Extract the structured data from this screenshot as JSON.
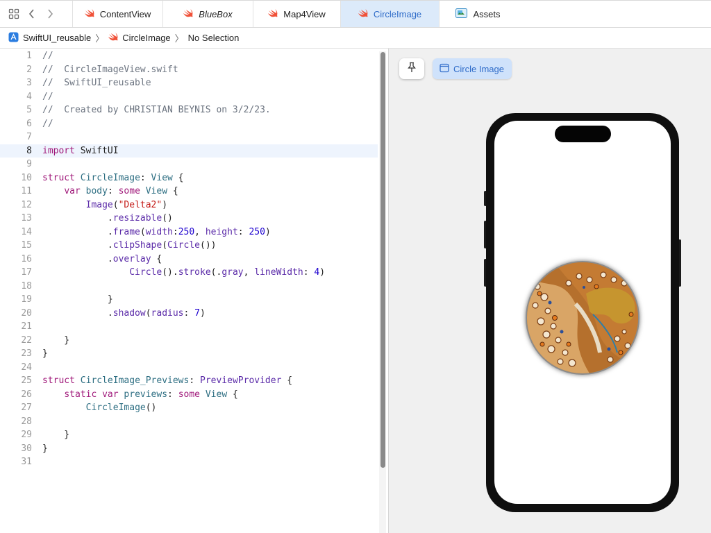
{
  "toolbar": {
    "nav": [
      "grid-icon",
      "back-icon",
      "forward-icon"
    ],
    "tabs": [
      {
        "label": "ContentView",
        "icon": "swift-icon",
        "italic": false,
        "active": false
      },
      {
        "label": "BlueBox",
        "icon": "swift-icon",
        "italic": true,
        "active": false
      },
      {
        "label": "Map4View",
        "icon": "swift-icon",
        "italic": false,
        "active": false
      },
      {
        "label": "CircleImage",
        "icon": "swift-icon",
        "italic": false,
        "active": true
      },
      {
        "label": "Assets",
        "icon": "asset-catalog-icon",
        "italic": false,
        "active": false
      }
    ]
  },
  "breadcrumb": {
    "project": "SwiftUI_reusable",
    "file": "CircleImage",
    "selection": "No Selection"
  },
  "editor": {
    "current_line": 8,
    "lines": [
      {
        "n": "1",
        "t": [
          [
            "cmt",
            "//"
          ]
        ]
      },
      {
        "n": "2",
        "t": [
          [
            "cmt",
            "//  CircleImageView.swift"
          ]
        ]
      },
      {
        "n": "3",
        "t": [
          [
            "cmt",
            "//  SwiftUI_reusable"
          ]
        ]
      },
      {
        "n": "4",
        "t": [
          [
            "cmt",
            "//"
          ]
        ]
      },
      {
        "n": "5",
        "t": [
          [
            "cmt",
            "//  Created by CHRISTIAN BEYNIS on 3/2/23."
          ]
        ]
      },
      {
        "n": "6",
        "t": [
          [
            "cmt",
            "//"
          ]
        ]
      },
      {
        "n": "7",
        "t": []
      },
      {
        "n": "8",
        "t": [
          [
            "kw",
            "import"
          ],
          [
            "",
            " SwiftUI"
          ]
        ]
      },
      {
        "n": "9",
        "t": []
      },
      {
        "n": "10",
        "t": [
          [
            "kw",
            "struct"
          ],
          [
            "",
            " "
          ],
          [
            "ty",
            "CircleImage"
          ],
          [
            "",
            ": "
          ],
          [
            "ty",
            "View"
          ],
          [
            "",
            " {"
          ]
        ]
      },
      {
        "n": "11",
        "t": [
          [
            "",
            "    "
          ],
          [
            "kw",
            "var"
          ],
          [
            "",
            " "
          ],
          [
            "ty",
            "body"
          ],
          [
            "",
            ": "
          ],
          [
            "kw",
            "some"
          ],
          [
            "",
            " "
          ],
          [
            "ty",
            "View"
          ],
          [
            "",
            " {"
          ]
        ]
      },
      {
        "n": "12",
        "t": [
          [
            "",
            "        "
          ],
          [
            "fn",
            "Image"
          ],
          [
            "",
            "("
          ],
          [
            "str",
            "\"Delta2\""
          ],
          [
            "",
            ")"
          ]
        ]
      },
      {
        "n": "13",
        "t": [
          [
            "",
            "            ."
          ],
          [
            "fn",
            "resizable"
          ],
          [
            "",
            "()"
          ]
        ]
      },
      {
        "n": "14",
        "t": [
          [
            "",
            "            ."
          ],
          [
            "fn",
            "frame"
          ],
          [
            "",
            "("
          ],
          [
            "fn",
            "width"
          ],
          [
            "",
            ":"
          ],
          [
            "num",
            "250"
          ],
          [
            "",
            ", "
          ],
          [
            "fn",
            "height"
          ],
          [
            "",
            ": "
          ],
          [
            "num",
            "250"
          ],
          [
            "",
            ")"
          ]
        ]
      },
      {
        "n": "15",
        "t": [
          [
            "",
            "            ."
          ],
          [
            "fn",
            "clipShape"
          ],
          [
            "",
            "("
          ],
          [
            "fn",
            "Circle"
          ],
          [
            "",
            "())"
          ]
        ]
      },
      {
        "n": "16",
        "t": [
          [
            "",
            "            ."
          ],
          [
            "fn",
            "overlay"
          ],
          [
            "",
            " {"
          ]
        ]
      },
      {
        "n": "17",
        "t": [
          [
            "",
            "                "
          ],
          [
            "fn",
            "Circle"
          ],
          [
            "",
            "()."
          ],
          [
            "fn",
            "stroke"
          ],
          [
            "",
            "(."
          ],
          [
            "fn",
            "gray"
          ],
          [
            "",
            ", "
          ],
          [
            "fn",
            "lineWidth"
          ],
          [
            "",
            ": "
          ],
          [
            "num",
            "4"
          ],
          [
            "",
            ")"
          ]
        ]
      },
      {
        "n": "18",
        "t": []
      },
      {
        "n": "19",
        "t": [
          [
            "",
            "            }"
          ]
        ]
      },
      {
        "n": "20",
        "t": [
          [
            "",
            "            ."
          ],
          [
            "fn",
            "shadow"
          ],
          [
            "",
            "("
          ],
          [
            "fn",
            "radius"
          ],
          [
            "",
            ": "
          ],
          [
            "num",
            "7"
          ],
          [
            "",
            ")"
          ]
        ]
      },
      {
        "n": "21",
        "t": []
      },
      {
        "n": "22",
        "t": [
          [
            "",
            "    }"
          ]
        ]
      },
      {
        "n": "23",
        "t": [
          [
            "",
            "}"
          ]
        ]
      },
      {
        "n": "24",
        "t": []
      },
      {
        "n": "25",
        "t": [
          [
            "kw",
            "struct"
          ],
          [
            "",
            " "
          ],
          [
            "ty",
            "CircleImage_Previews"
          ],
          [
            "",
            ": "
          ],
          [
            "fn",
            "PreviewProvider"
          ],
          [
            "",
            " {"
          ]
        ]
      },
      {
        "n": "26",
        "t": [
          [
            "",
            "    "
          ],
          [
            "kw",
            "static"
          ],
          [
            "",
            " "
          ],
          [
            "kw",
            "var"
          ],
          [
            "",
            " "
          ],
          [
            "ty",
            "previews"
          ],
          [
            "",
            ": "
          ],
          [
            "kw",
            "some"
          ],
          [
            "",
            " "
          ],
          [
            "ty",
            "View"
          ],
          [
            "",
            " {"
          ]
        ]
      },
      {
        "n": "27",
        "t": [
          [
            "",
            "        "
          ],
          [
            "ty",
            "CircleImage"
          ],
          [
            "",
            "()"
          ]
        ]
      },
      {
        "n": "28",
        "t": []
      },
      {
        "n": "29",
        "t": [
          [
            "",
            "    }"
          ]
        ]
      },
      {
        "n": "30",
        "t": [
          [
            "",
            "}"
          ]
        ]
      },
      {
        "n": "31",
        "t": []
      }
    ]
  },
  "preview": {
    "pin_icon": "pin-icon",
    "chip_label": "Circle Image",
    "chip_icon": "preview-window-icon",
    "image_name": "Delta2"
  },
  "colors": {
    "accent": "#2f6cc9",
    "swift_orange": "#f05138",
    "keyword": "#a0197a",
    "comment": "#6c7480",
    "string": "#c41a16",
    "number": "#1c00cf"
  }
}
